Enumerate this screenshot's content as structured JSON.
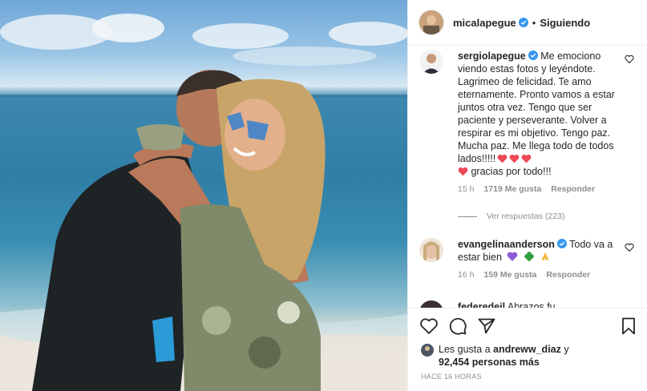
{
  "post": {
    "photo_alt": "couple hugging on beach"
  },
  "header": {
    "username": "micalapegue",
    "separator": "•",
    "follow_status": "Siguiendo"
  },
  "comments": [
    {
      "username": "sergiolapegue",
      "text": "Me emociono viendo estas fotos y leyéndote. Lagrimeo de felicidad. Te amo eternamente. Pronto vamos a estar juntos otra vez. Tengo que ser paciente y perseverante. Volver a respirar es mi objetivo. Tengo paz. Mucha paz. Me llega todo de todos lados!!!!!",
      "text_tail": "gracias por todo!!!",
      "time": "15 h",
      "likes": "1719 Me gusta",
      "reply": "Responder"
    },
    {
      "username": "evangelinaanderson",
      "text": "Todo va a estar bien",
      "time": "16 h",
      "likes": "159 Me gusta",
      "reply": "Responder"
    },
    {
      "username": "federedeil",
      "text": "Abrazos fu"
    }
  ],
  "view_replies": "Ver respuestas (223)",
  "likes_summary": {
    "prefix": "Les gusta a",
    "user": "andreww_diaz",
    "conj": "y",
    "others": "92,454 personas más"
  },
  "timestamp": "HACE 16 HORAS",
  "colors": {
    "verified": "#3897f0",
    "heart": "#ed4956",
    "meta": "#8e8e8e",
    "border": "#efefef"
  },
  "icons": [
    "heart-icon",
    "comment-icon",
    "share-icon",
    "bookmark-icon",
    "verified-icon"
  ]
}
